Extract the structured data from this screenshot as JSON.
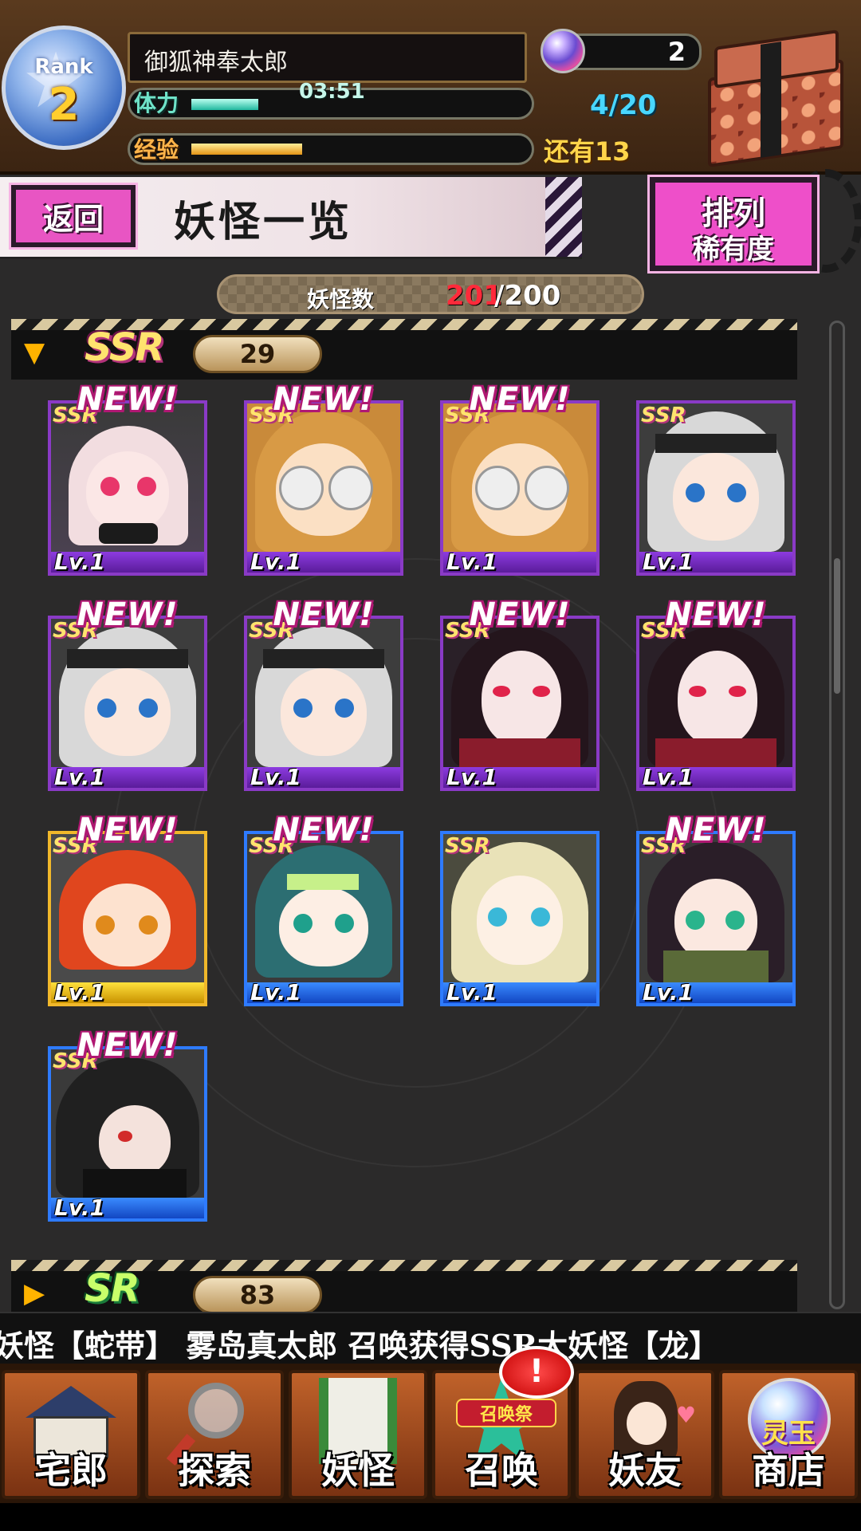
{
  "player": {
    "rank_label": "Rank",
    "rank": "2",
    "name": "御狐神奉太郎",
    "stamina_label": "体力",
    "stamina_timer": "03:51",
    "stamina_fill_fraction": 0.2,
    "stamina": "4/20",
    "exp_label": "经验",
    "exp_fill_fraction": 0.33,
    "exp_remaining": "还有13",
    "orbs": "2"
  },
  "header": {
    "back_label": "返回",
    "title": "妖怪一览",
    "sort_label": "排列",
    "sort_value": "稀有度"
  },
  "count": {
    "label": "妖怪数",
    "current": "201",
    "separator_max": "/200"
  },
  "sections": [
    {
      "rarity": "SSR",
      "count": "29",
      "expanded": true,
      "cards": [
        {
          "new": "NEW!",
          "rarity": "SSR",
          "level": "Lv.1",
          "frame": "purple",
          "character": "white-haired-horned-girl"
        },
        {
          "new": "NEW!",
          "rarity": "SSR",
          "level": "Lv.1",
          "frame": "purple",
          "character": "curly-blonde-glasses-girl"
        },
        {
          "new": "NEW!",
          "rarity": "SSR",
          "level": "Lv.1",
          "frame": "purple",
          "character": "curly-blonde-glasses-girl"
        },
        {
          "new": "",
          "rarity": "SSR",
          "level": "Lv.1",
          "frame": "purple",
          "character": "silver-haired-headband-girl"
        },
        {
          "new": "NEW!",
          "rarity": "SSR",
          "level": "Lv.1",
          "frame": "purple",
          "character": "silver-haired-headband-girl"
        },
        {
          "new": "NEW!",
          "rarity": "SSR",
          "level": "Lv.1",
          "frame": "purple",
          "character": "silver-haired-headband-girl"
        },
        {
          "new": "NEW!",
          "rarity": "SSR",
          "level": "Lv.1",
          "frame": "purple",
          "character": "black-haired-red-eyed-woman"
        },
        {
          "new": "NEW!",
          "rarity": "SSR",
          "level": "Lv.1",
          "frame": "purple",
          "character": "black-haired-red-eyed-woman"
        },
        {
          "new": "NEW!",
          "rarity": "SSR",
          "level": "Lv.1",
          "frame": "gold",
          "character": "red-haired-boy"
        },
        {
          "new": "NEW!",
          "rarity": "SSR",
          "level": "Lv.1",
          "frame": "blue",
          "character": "green-haired-shark-hood-kid"
        },
        {
          "new": "",
          "rarity": "SSR",
          "level": "Lv.1",
          "frame": "blue",
          "character": "blonde-blue-eyed-girl"
        },
        {
          "new": "NEW!",
          "rarity": "SSR",
          "level": "Lv.1",
          "frame": "blue",
          "character": "dark-haired-scarf-girl"
        },
        {
          "new": "NEW!",
          "rarity": "SSR",
          "level": "Lv.1",
          "frame": "blue",
          "character": "black-haired-masked-youth"
        }
      ]
    },
    {
      "rarity": "SR",
      "count": "83",
      "expanded": false
    }
  ],
  "ticker": "妖怪【蛇带】   雾岛真太郎 召唤获得SSR大妖怪【龙】",
  "nav": {
    "home": "宅郎",
    "explore": "探索",
    "yokai": "妖怪",
    "summon": "召唤",
    "summon_banner": "召唤祭",
    "summon_alert": "!",
    "friends": "妖友",
    "shop": "商店",
    "shop_orb": "灵玉"
  },
  "colors": {
    "card_frame_purple": "#8a3ac6",
    "card_frame_gold": "#f1b82a",
    "card_frame_blue": "#2e7bff",
    "new_badge": "#b01873",
    "count_current": "#ff2a3a",
    "button_pink": "#e855c3"
  },
  "icons": [
    "rank-star-icon",
    "spirit-orb-icon",
    "treasure-chest-icon",
    "expand-arrow-icon",
    "collapse-arrow-icon",
    "gear-icon",
    "house-icon",
    "magnifier-map-icon",
    "scroll-icon",
    "summon-star-icon",
    "fox-girl-icon",
    "shop-orb-icon"
  ]
}
